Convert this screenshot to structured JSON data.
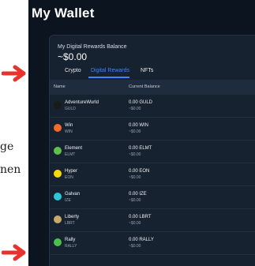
{
  "page": {
    "bg_text": [
      "ge",
      "nen"
    ]
  },
  "app": {
    "title": "My Wallet",
    "balance_label": "My Digital Rewards Balance",
    "balance_value": "~$0.00",
    "tabs": [
      {
        "label": "Crypto",
        "active": false
      },
      {
        "label": "Digital Rewards",
        "active": true
      },
      {
        "label": "NFTs",
        "active": false
      }
    ],
    "columns": [
      "Name",
      "Current Balance"
    ],
    "rows": [
      {
        "name": "AdventureWurld",
        "symbol": "GULD",
        "balance": "0.00 GULD",
        "usd": "~$0.00",
        "icon": "adventurewurld-logo-icon",
        "icon_color": "#1a1a1a"
      },
      {
        "name": "Win",
        "symbol": "WIN",
        "balance": "0.00 WIN",
        "usd": "~$0.00",
        "icon": "win-logo-icon",
        "icon_color": "#f26a2e"
      },
      {
        "name": "Element",
        "symbol": "ELMT",
        "balance": "0.00 ELMT",
        "usd": "~$0.00",
        "icon": "element-logo-icon",
        "icon_color": "#5fbf4a"
      },
      {
        "name": "Hyper",
        "symbol": "EON",
        "balance": "0.00 EON",
        "usd": "~$0.00",
        "icon": "hyper-logo-icon",
        "icon_color": "#f5d90a"
      },
      {
        "name": "Galvan",
        "symbol": "IZE",
        "balance": "0.00 IZE",
        "usd": "~$0.00",
        "icon": "galvan-logo-icon",
        "icon_color": "#2ec7d9"
      },
      {
        "name": "Liberty",
        "symbol": "LBRT",
        "balance": "0.00 LBRT",
        "usd": "~$0.00",
        "icon": "liberty-logo-icon",
        "icon_color": "#c9a96a"
      },
      {
        "name": "Rally",
        "symbol": "RALLY",
        "balance": "0.00 RALLY",
        "usd": "~$0.00",
        "icon": "rally-logo-icon",
        "icon_color": "#4bbf4a"
      }
    ]
  },
  "colors": {
    "annotation_red": "#e8322c",
    "accent_blue": "#3a86ff",
    "app_bg": "#0c1420",
    "panel_bg": "#172231"
  }
}
